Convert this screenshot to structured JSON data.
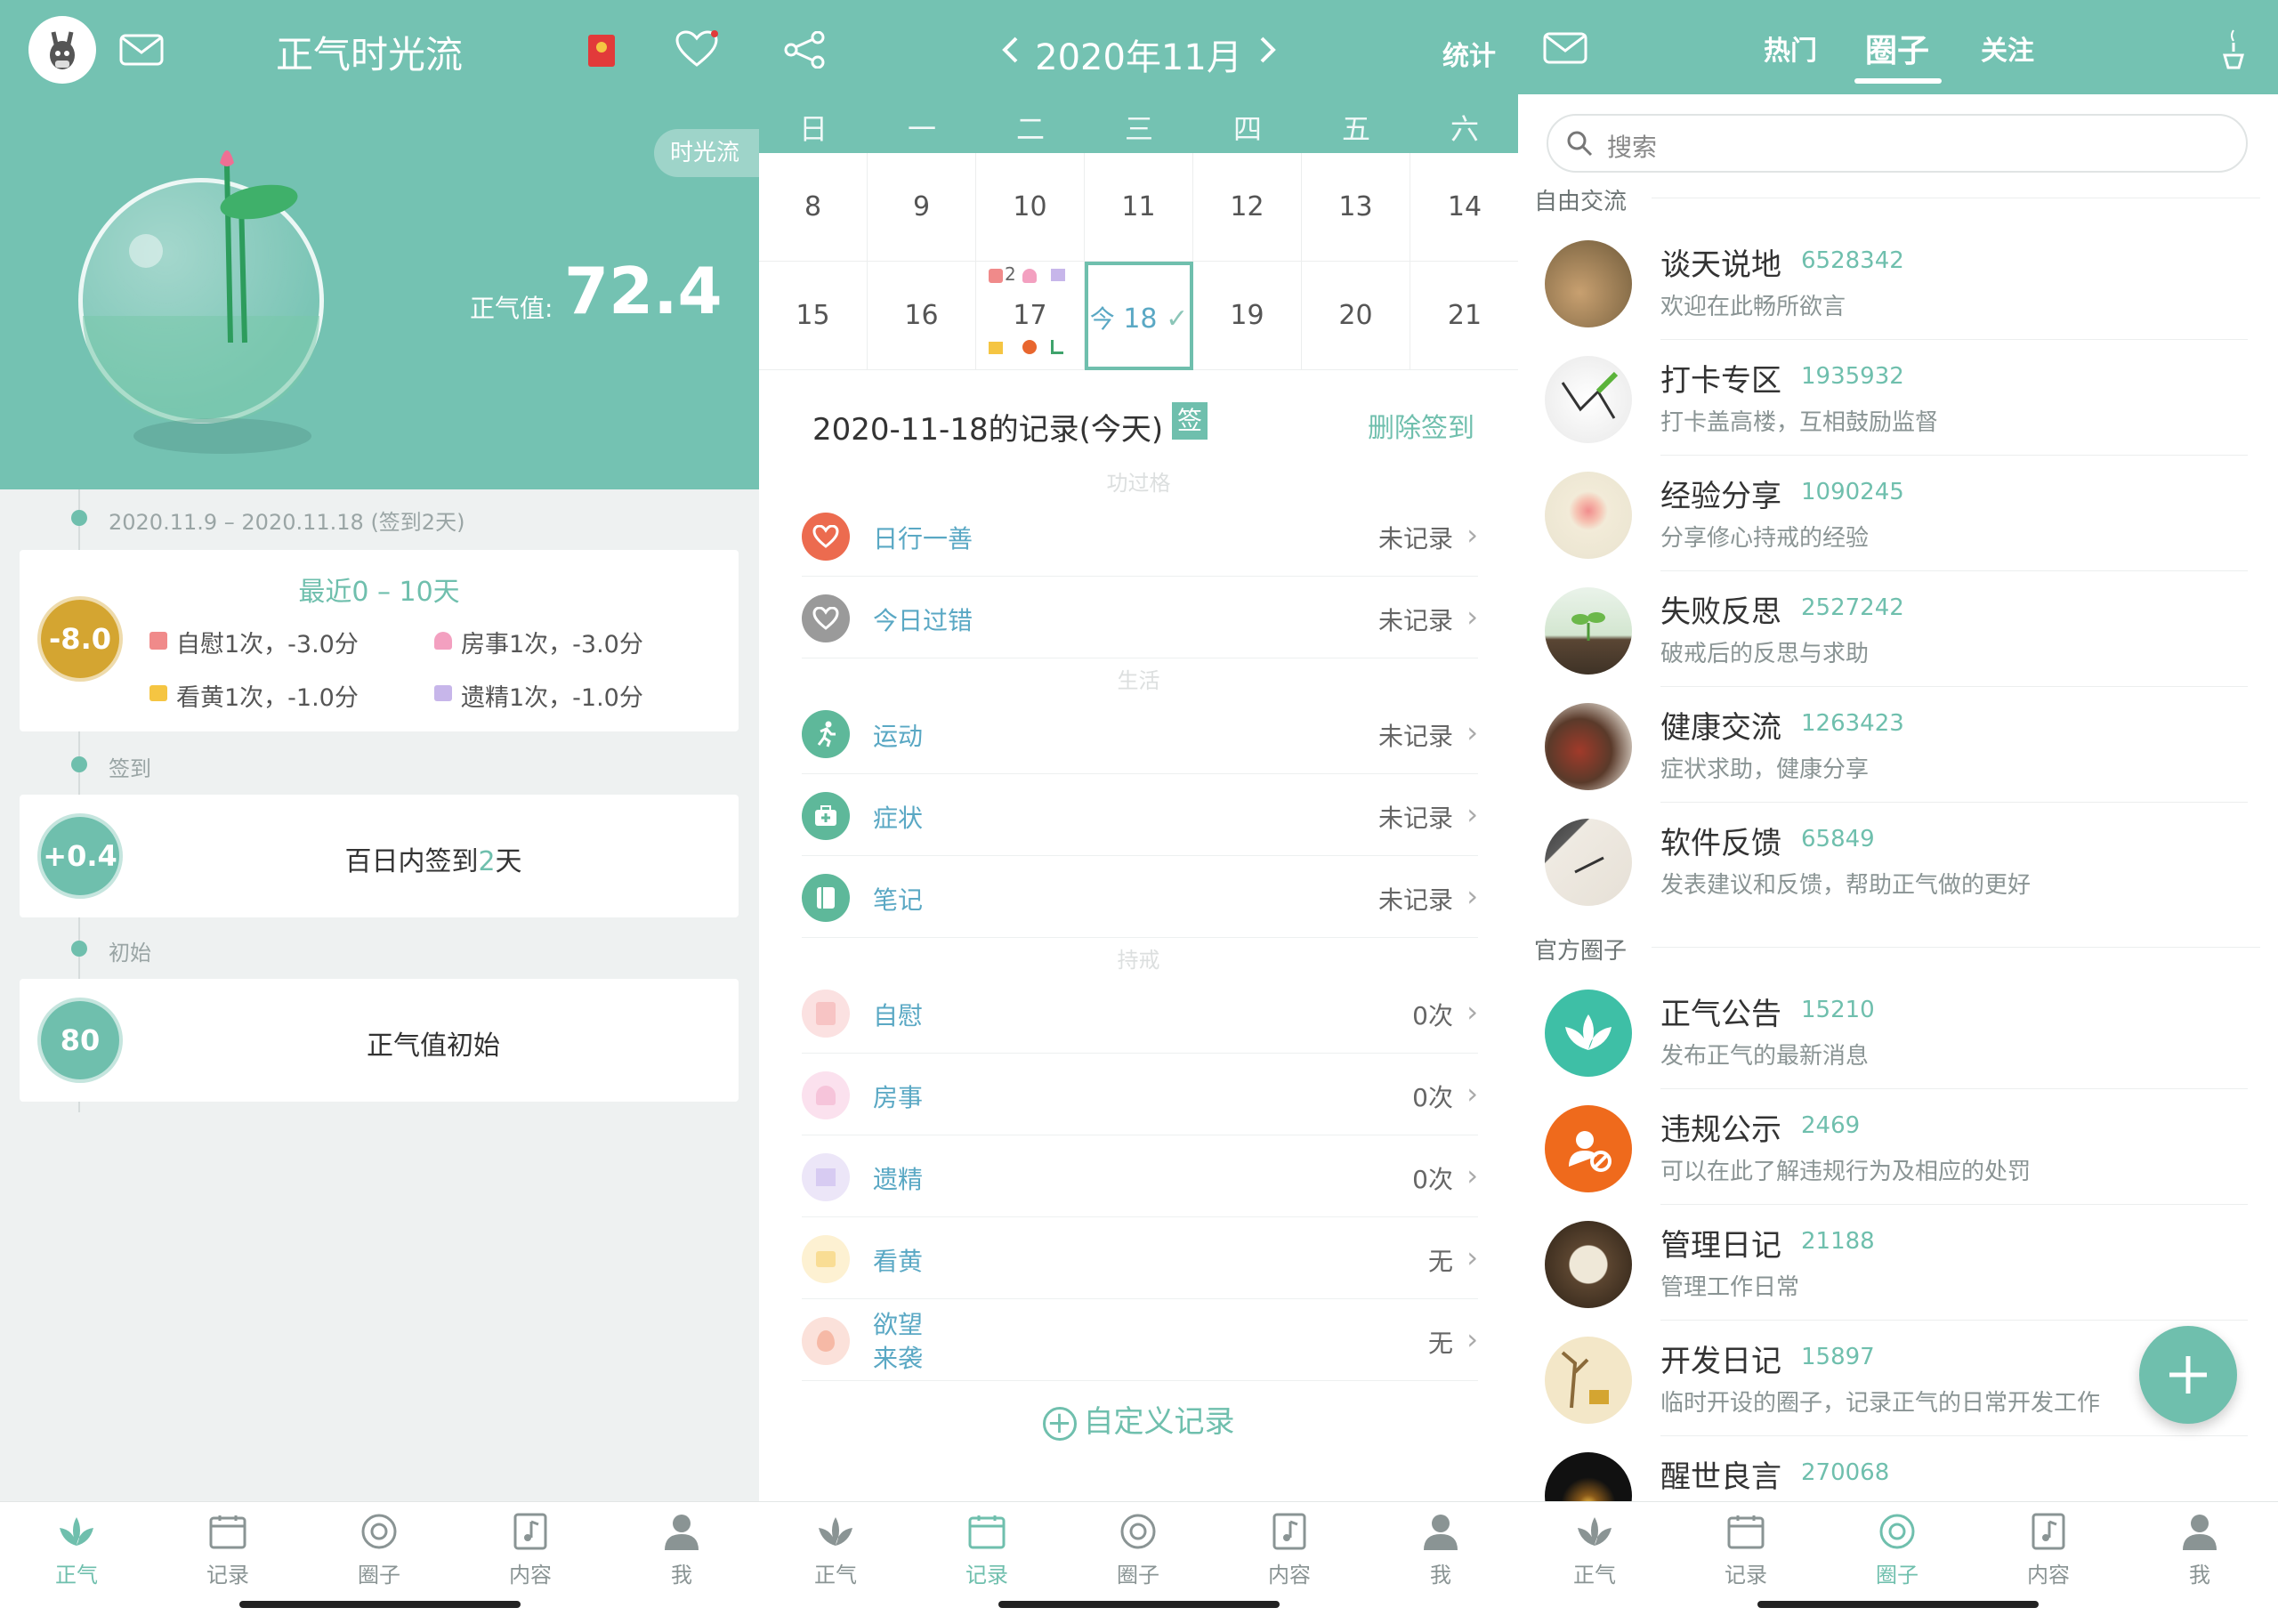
{
  "colors": {
    "accent": "#6fbfad",
    "header": "#74c2b2",
    "gold": "#d4a531",
    "link": "#5aa8c4"
  },
  "panel1": {
    "title": "正气时光流",
    "flow_tag": "时光流",
    "score_label": "正气值:",
    "score_value": "72.4",
    "timeline": [
      {
        "label": "2020.11.9 – 2020.11.18 (签到2天)"
      },
      {
        "label": "签到"
      },
      {
        "label": "初始"
      }
    ],
    "card1": {
      "heading": "最近0 – 10天",
      "badge": "-8.0",
      "items": [
        "自慰1次，-3.0分",
        "房事1次，-3.0分",
        "看黄1次，-1.0分",
        "遗精1次，-1.0分"
      ]
    },
    "card2": {
      "badge": "+0.4",
      "text_a": "百日内签到",
      "text_b": "2",
      "text_c": "天"
    },
    "card3": {
      "badge": "80",
      "text": "正气值初始"
    }
  },
  "panel2": {
    "month": "2020年11月",
    "stats": "统计",
    "weekdays": [
      "日",
      "一",
      "二",
      "三",
      "四",
      "五",
      "六"
    ],
    "week1": [
      "8",
      "9",
      "10",
      "11",
      "12",
      "13",
      "14"
    ],
    "week2": [
      "15",
      "16",
      "17",
      "18",
      "19",
      "20",
      "21"
    ],
    "today_prefix": "今",
    "mark_count": "2",
    "record_title": "2020-11-18的记录(今天)",
    "sign_badge": "签",
    "delete_sign": "删除签到",
    "sections": [
      "功过格",
      "生活",
      "持戒"
    ],
    "rows": [
      {
        "label": "日行一善",
        "value": "未记录"
      },
      {
        "label": "今日过错",
        "value": "未记录"
      },
      {
        "label": "运动",
        "value": "未记录"
      },
      {
        "label": "症状",
        "value": "未记录"
      },
      {
        "label": "笔记",
        "value": "未记录"
      },
      {
        "label": "自慰",
        "value": "0次"
      },
      {
        "label": "房事",
        "value": "0次"
      },
      {
        "label": "遗精",
        "value": "0次"
      },
      {
        "label": "看黄",
        "value": "无"
      },
      {
        "label": "欲望\n来袭",
        "value": "无"
      }
    ],
    "custom_record": "自定义记录"
  },
  "panel3": {
    "tabs": [
      "热门",
      "圈子",
      "关注"
    ],
    "search_placeholder": "搜索",
    "group1": "自由交流",
    "group2": "官方圈子",
    "circles1": [
      {
        "name": "谈天说地",
        "count": "6528342",
        "desc": "欢迎在此畅所欲言"
      },
      {
        "name": "打卡专区",
        "count": "1935932",
        "desc": "打卡盖高楼，互相鼓励监督"
      },
      {
        "name": "经验分享",
        "count": "1090245",
        "desc": "分享修心持戒的经验"
      },
      {
        "name": "失败反思",
        "count": "2527242",
        "desc": "破戒后的反思与求助"
      },
      {
        "name": "健康交流",
        "count": "1263423",
        "desc": "症状求助，健康分享"
      },
      {
        "name": "软件反馈",
        "count": "65849",
        "desc": "发表建议和反馈，帮助正气做的更好"
      }
    ],
    "circles2": [
      {
        "name": "正气公告",
        "count": "15210",
        "desc": "发布正气的最新消息"
      },
      {
        "name": "违规公示",
        "count": "2469",
        "desc": "可以在此了解违规行为及相应的处罚"
      },
      {
        "name": "管理日记",
        "count": "21188",
        "desc": "管理工作日常"
      },
      {
        "name": "开发日记",
        "count": "15897",
        "desc": "临时开设的圈子，记录正气的日常开发工作"
      },
      {
        "name": "醒世良言",
        "count": "270068",
        "desc": ""
      }
    ]
  },
  "tabbar": [
    "正气",
    "记录",
    "圈子",
    "内容",
    "我"
  ]
}
